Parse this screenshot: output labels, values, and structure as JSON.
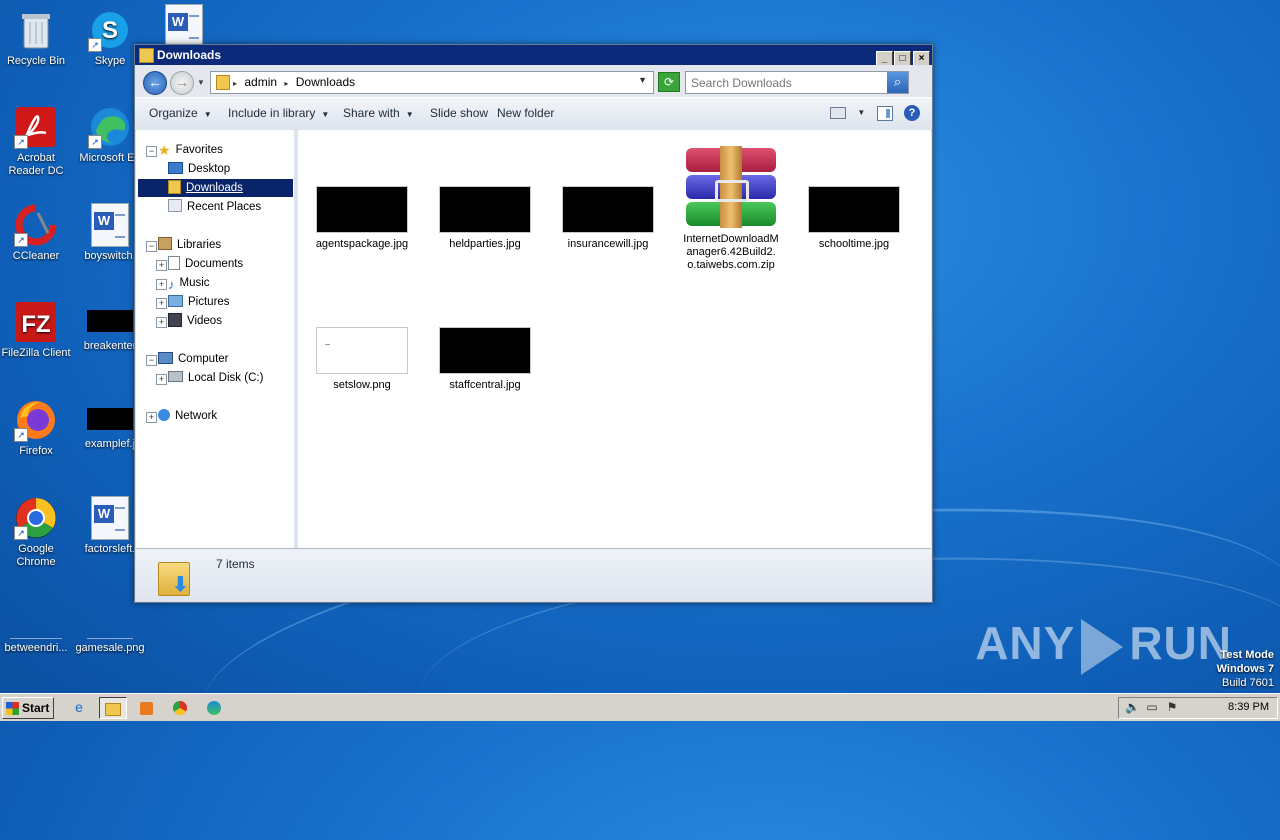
{
  "desktop": {
    "icons": [
      {
        "label": "Recycle Bin",
        "icon": "recycle-bin-icon"
      },
      {
        "label": "Skype",
        "icon": "skype-icon"
      },
      {
        "label": "Acrobat Reader DC",
        "icon": "acrobat-icon"
      },
      {
        "label": "Microsoft Ed",
        "icon": "edge-icon"
      },
      {
        "label": "CCleaner",
        "icon": "ccleaner-icon"
      },
      {
        "label": "boyswitch.",
        "icon": "word-doc-icon"
      },
      {
        "label": "FileZilla Client",
        "icon": "filezilla-icon"
      },
      {
        "label": "breakenter",
        "icon": "image-thumbnail-icon"
      },
      {
        "label": "Firefox",
        "icon": "firefox-icon"
      },
      {
        "label": "examplef.j",
        "icon": "image-thumbnail-icon"
      },
      {
        "label": "Google Chrome",
        "icon": "chrome-icon"
      },
      {
        "label": "factorsleft.",
        "icon": "word-doc-icon"
      },
      {
        "label": "betweendri...",
        "icon": "image-thumbnail-icon"
      },
      {
        "label": "gamesale.png",
        "icon": "image-thumbnail-icon"
      }
    ]
  },
  "window": {
    "title": "Downloads",
    "controls": {
      "minimize": "_",
      "maximize": "□",
      "close": "×"
    },
    "address": {
      "crumbs": [
        "admin",
        "Downloads"
      ]
    },
    "search": {
      "placeholder": "Search Downloads"
    },
    "toolbar": {
      "organize": "Organize",
      "include": "Include in library",
      "share": "Share with",
      "slideshow": "Slide show",
      "newfolder": "New folder"
    },
    "nav": {
      "favorites": "Favorites",
      "desktop": "Desktop",
      "downloads": "Downloads",
      "recent": "Recent Places",
      "libraries": "Libraries",
      "documents": "Documents",
      "music": "Music",
      "pictures": "Pictures",
      "videos": "Videos",
      "computer": "Computer",
      "localdisk": "Local Disk (C:)",
      "network": "Network"
    },
    "files": [
      {
        "name": "agentspackage.jpg",
        "kind": "black-image"
      },
      {
        "name": "heldparties.jpg",
        "kind": "black-image"
      },
      {
        "name": "insurancewill.jpg",
        "kind": "black-image"
      },
      {
        "name": "InternetDownloadManager6.42Build2.o.taiwebs.com.zip",
        "kind": "winrar-archive"
      },
      {
        "name": "schooltime.jpg",
        "kind": "black-image"
      },
      {
        "name": "setslow.png",
        "kind": "white-image"
      },
      {
        "name": "staffcentral.jpg",
        "kind": "black-image"
      }
    ],
    "status": {
      "count": "7 items"
    }
  },
  "taskbar": {
    "start": "Start",
    "clock": "8:39 PM"
  },
  "watermark": {
    "left": "ANY",
    "right": "RUN"
  },
  "testmode": {
    "line1": "Test Mode",
    "line2": "Windows 7",
    "line3": "Build 7601"
  }
}
